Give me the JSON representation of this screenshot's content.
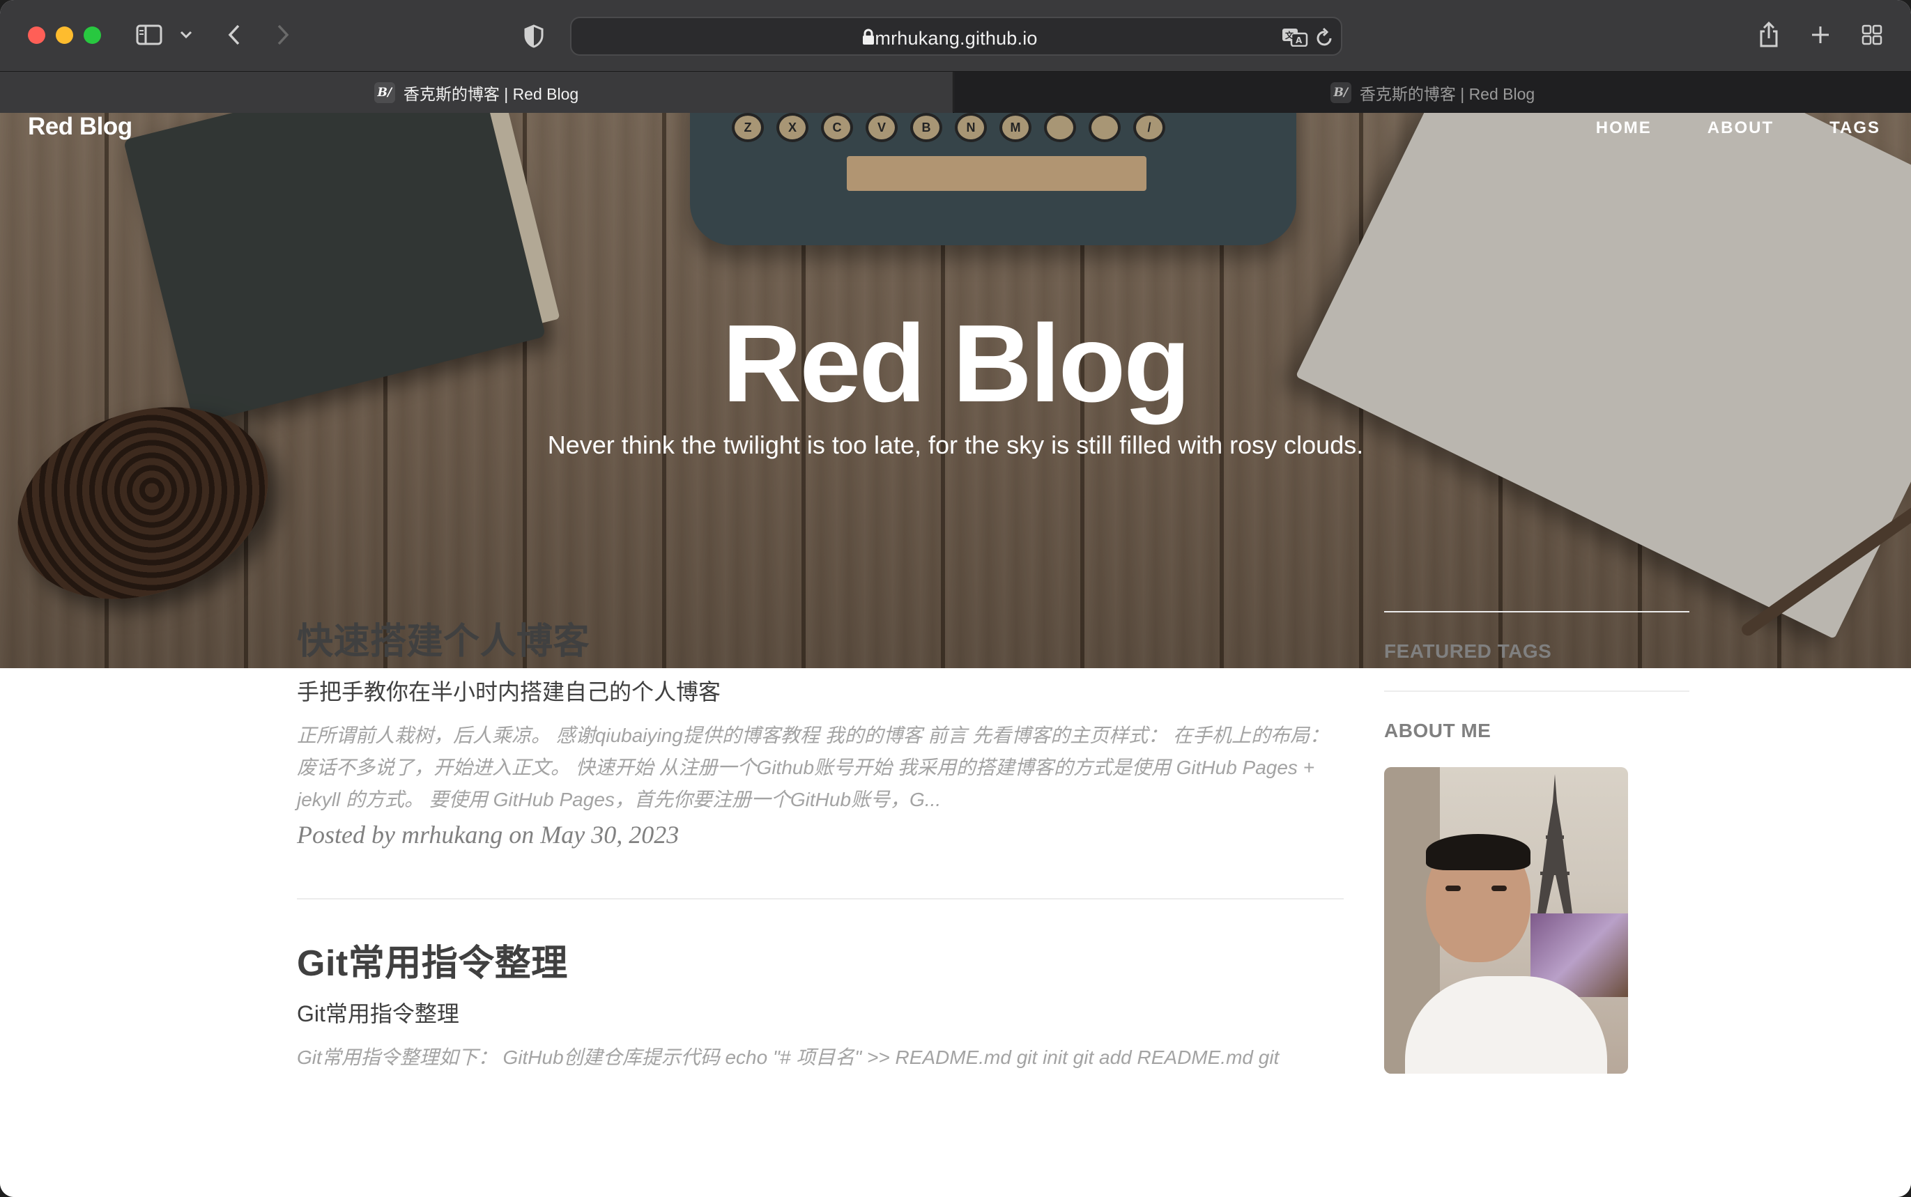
{
  "browser": {
    "url": "mrhukang.github.io",
    "tabs": [
      {
        "favicon": "B/",
        "title": "香克斯的博客 | Red Blog",
        "active": true
      },
      {
        "favicon": "B/",
        "title": "香克斯的博客 | Red Blog",
        "active": false
      }
    ],
    "icons": [
      "sidebar-icon",
      "chevron-down-icon",
      "back-icon",
      "forward-icon",
      "shield-icon",
      "lock-icon",
      "translate-icon",
      "reload-icon",
      "share-icon",
      "new-tab-icon",
      "tab-overview-icon"
    ]
  },
  "site": {
    "brand": "Red Blog",
    "nav": [
      "HOME",
      "ABOUT",
      "TAGS"
    ],
    "hero_title": "Red Blog",
    "hero_subtitle": "Never think the twilight is too late, for the sky is still filled with rosy clouds.",
    "typewriter_keys": [
      "Z",
      "X",
      "C",
      "V",
      "B",
      "N",
      "M",
      "",
      "",
      "/"
    ]
  },
  "posts": [
    {
      "title": "快速搭建个人博客",
      "subtitle": "手把手教你在半小时内搭建自己的个人博客",
      "excerpt": "正所谓前人栽树，后人乘凉。 感谢qiubaiying提供的博客教程 我的的博客 前言 先看博客的主页样式： 在手机上的布局： 废话不多说了，开始进入正文。 快速开始 从注册一个Github账号开始 我采用的搭建博客的方式是使用 GitHub Pages + jekyll 的方式。 要使用 GitHub Pages，首先你要注册一个GitHub账号，G...",
      "meta": "Posted by mrhukang on May 30, 2023"
    },
    {
      "title": "Git常用指令整理",
      "subtitle": "Git常用指令整理",
      "excerpt": "Git常用指令整理如下： GitHub创建仓库提示代码 echo \"# 项目名\" >> README.md git init git add README.md git"
    }
  ],
  "sidebar": {
    "featured_tags_heading": "FEATURED TAGS",
    "about_heading": "ABOUT ME"
  },
  "colors": {
    "toolbar_bg": "#3a3a3c",
    "text_dark": "#404040",
    "text_muted": "#a3a3a3",
    "meta_gray": "#808080"
  }
}
